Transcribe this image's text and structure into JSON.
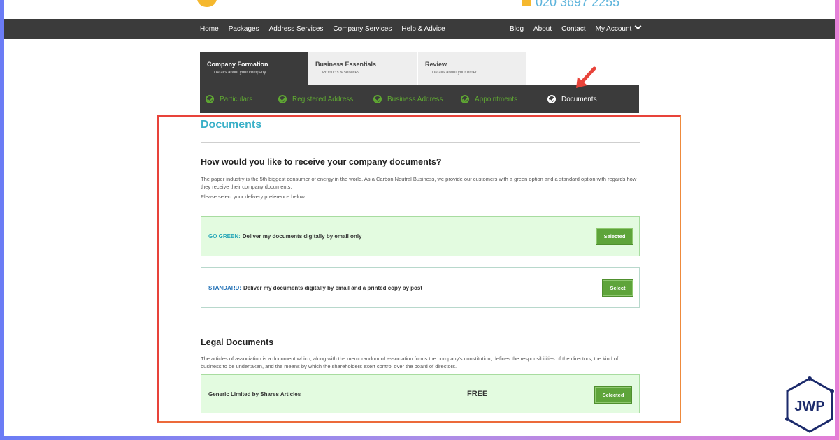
{
  "header": {
    "phone": "020 3697 2255"
  },
  "nav": {
    "left": [
      "Home",
      "Packages",
      "Address Services",
      "Company Services",
      "Help & Advice"
    ],
    "right": [
      "Blog",
      "About",
      "Contact",
      "My Account"
    ]
  },
  "tabs": [
    {
      "title": "Company Formation",
      "subtitle": "Details about your company"
    },
    {
      "title": "Business Essentials",
      "subtitle": "Products & services"
    },
    {
      "title": "Review",
      "subtitle": "Details about your order"
    }
  ],
  "steps": [
    "Particulars",
    "Registered Address",
    "Business Address",
    "Appointments",
    "Documents"
  ],
  "documents": {
    "title": "Documents",
    "question": "How would you like to receive your company documents?",
    "intro": "The paper industry is the 5th biggest consumer of energy in the world. As a Carbon Neutral Business, we provide our customers with a green option and a standard option with regards how they receive their company documents.",
    "select_prompt": "Please select your delivery preference below:",
    "options": [
      {
        "label": "GO GREEN:",
        "text": "Deliver my documents digitally by email only",
        "button": "Selected"
      },
      {
        "label": "STANDARD:",
        "text": "Deliver my documents digitally by email and a printed copy by post",
        "button": "Select"
      }
    ]
  },
  "legal": {
    "title": "Legal Documents",
    "text": "The articles of association is a document which, along with the memorandum of association forms the company's constitution, defines the responsibilities of the directors, the kind of business to be undertaken, and the means by which the shareholders exert control over the board of directors.",
    "item_name": "Generic Limited by Shares Articles",
    "item_price": "FREE",
    "item_button": "Selected"
  },
  "brand": {
    "badge": "JWP"
  },
  "colors": {
    "accent_teal": "#3ab0c8",
    "green": "#5ea43a",
    "annotation_red": "#e8433a",
    "nav_bg": "#3b3b3b"
  }
}
